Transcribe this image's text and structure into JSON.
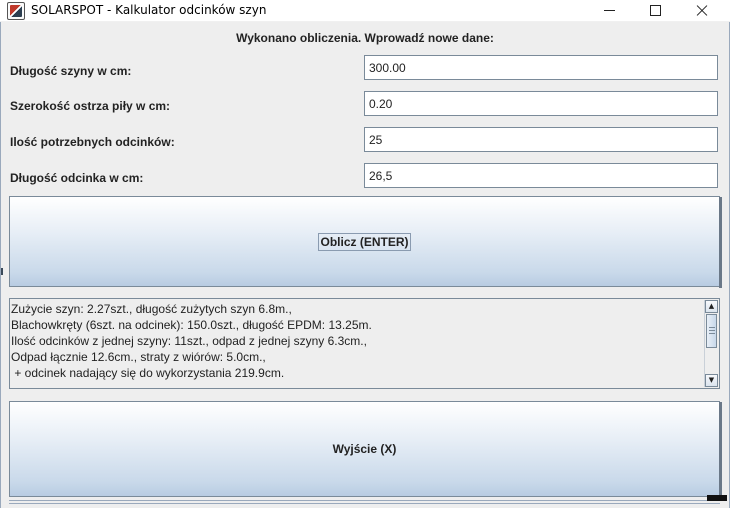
{
  "window": {
    "title": "SOLARSPOT - Kalkulator odcinków szyn",
    "controls": {
      "minimize": "minimize",
      "maximize": "maximize",
      "close": "close"
    }
  },
  "status_message": "Wykonano obliczenia. Wprowadź nowe dane:",
  "form": {
    "rail_length": {
      "label": "Długość szyny w cm:",
      "value": "300.00"
    },
    "saw_width": {
      "label": "Szerokość ostrza piły w cm:",
      "value": "0.20"
    },
    "segment_count": {
      "label": "Ilość potrzebnych odcinków:",
      "value": "25"
    },
    "segment_length": {
      "label": "Długość odcinka w cm:",
      "value": "26,5"
    }
  },
  "buttons": {
    "calculate": "Oblicz (ENTER)",
    "exit": "Wyjście (X)"
  },
  "results": {
    "lines": [
      "Zużycie szyn: 2.27szt., długość zużytych szyn 6.8m.,",
      "Blachowkręty (6szt. na odcinek): 150.0szt., długość EPDM: 13.25m.",
      "Ilość odcinków z jednej szyny: 11szt., odpad z jednej szyny 6.3cm.,",
      "Odpad łącznie 12.6cm., straty z wiórów: 5.0cm.,",
      " + odcinek nadający się do wykorzystania 219.9cm."
    ]
  },
  "colors": {
    "window_background": "#eeeeee",
    "button_gradient_top": "#ffffff",
    "button_gradient_bottom": "#b8cce2",
    "border": "#7a8a99"
  },
  "icons": [
    "app-icon",
    "minimize-icon",
    "maximize-icon",
    "close-icon",
    "scroll-up-icon",
    "scroll-down-icon"
  ]
}
